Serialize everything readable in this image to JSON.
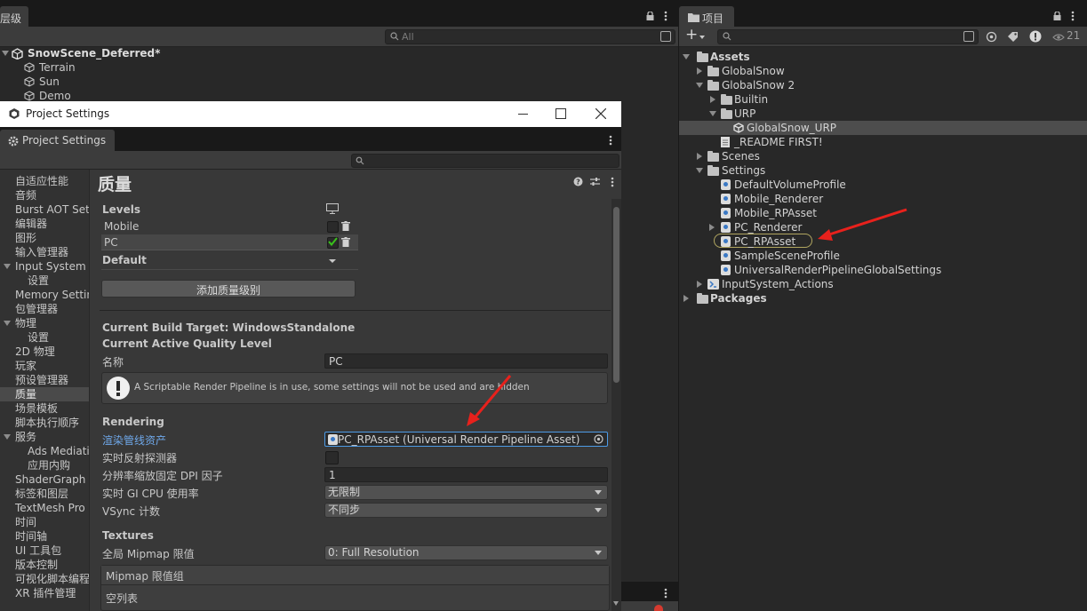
{
  "hierarchy": {
    "tab_label": "层级",
    "search_placeholder": "All",
    "scene_name": "SnowScene_Deferred*",
    "items": [
      "Terrain",
      "Sun",
      "Demo"
    ]
  },
  "project": {
    "tab_label": "项目",
    "add_label": "+",
    "hidden_count": "21",
    "tree": [
      {
        "label": "Assets",
        "bold": true
      },
      {
        "label": "GlobalSnow"
      },
      {
        "label": "GlobalSnow 2"
      },
      {
        "label": "Builtin"
      },
      {
        "label": "URP"
      },
      {
        "label": "GlobalSnow_URP"
      },
      {
        "label": "_README FIRST!"
      },
      {
        "label": "Scenes"
      },
      {
        "label": "Settings"
      },
      {
        "label": "DefaultVolumeProfile"
      },
      {
        "label": "Mobile_Renderer"
      },
      {
        "label": "Mobile_RPAsset"
      },
      {
        "label": "PC_Renderer"
      },
      {
        "label": "PC_RPAsset"
      },
      {
        "label": "SampleSceneProfile"
      },
      {
        "label": "UniversalRenderPipelineGlobalSettings"
      },
      {
        "label": "InputSystem_Actions"
      },
      {
        "label": "Packages",
        "bold": true
      }
    ]
  },
  "settings_window": {
    "title": "Project Settings",
    "tab_label": "Project Settings",
    "sidebar": [
      "自适应性能",
      "音频",
      "Burst AOT Settings",
      "编辑器",
      "图形",
      "输入管理器",
      "Input System Package",
      "设置",
      "Memory Settings",
      "包管理器",
      "物理",
      "设置",
      "2D 物理",
      "玩家",
      "预设管理器",
      "质量",
      "场景模板",
      "脚本执行顺序",
      "服务",
      "Ads Mediation",
      "应用内购",
      "ShaderGraph",
      "标签和图层",
      "TextMesh Pro",
      "时间",
      "时间轴",
      "UI 工具包",
      "版本控制",
      "可视化脚本编程",
      "XR 插件管理"
    ],
    "selected_sidebar_index": 15
  },
  "quality": {
    "heading": "质量",
    "levels_label": "Levels",
    "levels": [
      "Mobile",
      "PC"
    ],
    "default_label": "Default",
    "add_level_button": "添加质量级别",
    "build_target": "Current Build Target: WindowsStandalone",
    "active_level_label": "Current Active Quality Level",
    "name_label": "名称",
    "name_value": "PC",
    "warning": "A Scriptable Render Pipeline is in use, some settings will not be used and are hidden",
    "rendering_header": "Rendering",
    "rp_asset_label": "渲染管线资产",
    "rp_asset_value": "PC_RPAsset (Universal Render Pipeline Asset)",
    "realtime_probes_label": "实时反射探测器",
    "dpi_label": "分辨率缩放固定 DPI 因子",
    "dpi_value": "1",
    "gi_label": "实时 GI CPU 使用率",
    "gi_value": "无限制",
    "vsync_label": "VSync 计数",
    "vsync_value": "不同步",
    "textures_header": "Textures",
    "mipmap_label": "全局 Mipmap 限值",
    "mipmap_value": "0: Full Resolution",
    "mipmap_groups_label": "Mipmap 限值组",
    "empty_list_label": "空列表"
  },
  "colors": {
    "accent_blue": "#4d9be6",
    "annotation_red": "#e8211c",
    "check_green": "#39c21b"
  }
}
